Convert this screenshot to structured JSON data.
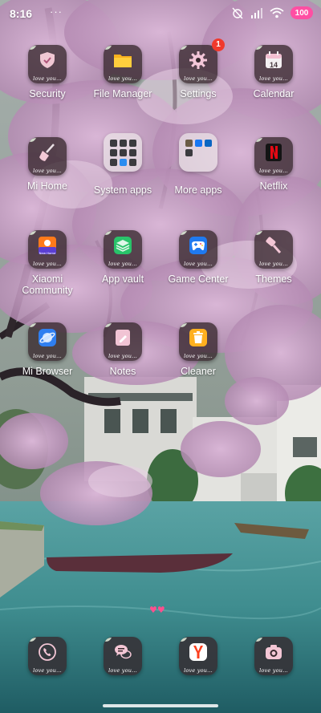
{
  "status_bar": {
    "time": "8:16",
    "dots": "···",
    "battery": "100"
  },
  "apps": {
    "security": {
      "label": "Security",
      "love": "love you..."
    },
    "file_manager": {
      "label": "File Manager",
      "love": "love you..."
    },
    "settings": {
      "label": "Settings",
      "love": "love you...",
      "badge": "1"
    },
    "calendar": {
      "label": "Calendar",
      "love": "love you...",
      "day": "14"
    },
    "mi_home": {
      "label": "Mi Home",
      "love": "love you..."
    },
    "system_apps": {
      "label": "System apps"
    },
    "more_apps": {
      "label": "More apps"
    },
    "netflix": {
      "label": "Netflix",
      "love": "love you..."
    },
    "xiaomi_community": {
      "label_line1": "Xiaomi",
      "label_line2": "Community",
      "love": "love you...",
      "inner_text": "New Home"
    },
    "app_vault": {
      "label": "App vault",
      "love": "love you..."
    },
    "game_center": {
      "label": "Game Center",
      "love": "love you..."
    },
    "themes": {
      "label": "Themes",
      "love": "love you..."
    },
    "mi_browser": {
      "label": "Mi Browser",
      "love": "love you..."
    },
    "notes": {
      "label": "Notes",
      "love": "love you..."
    },
    "cleaner": {
      "label": "Cleaner",
      "love": "love you..."
    }
  },
  "dock": {
    "phone": {
      "love": "love you..."
    },
    "messages": {
      "love": "love you..."
    },
    "yandex": {
      "love": "love you..."
    },
    "camera": {
      "love": "love you..."
    }
  },
  "colors": {
    "blossom": "#c9a3c6",
    "water": "#3f8d8f",
    "tile": "#37282d",
    "badge": "#f0392d",
    "battery": "#ff4fa3"
  }
}
